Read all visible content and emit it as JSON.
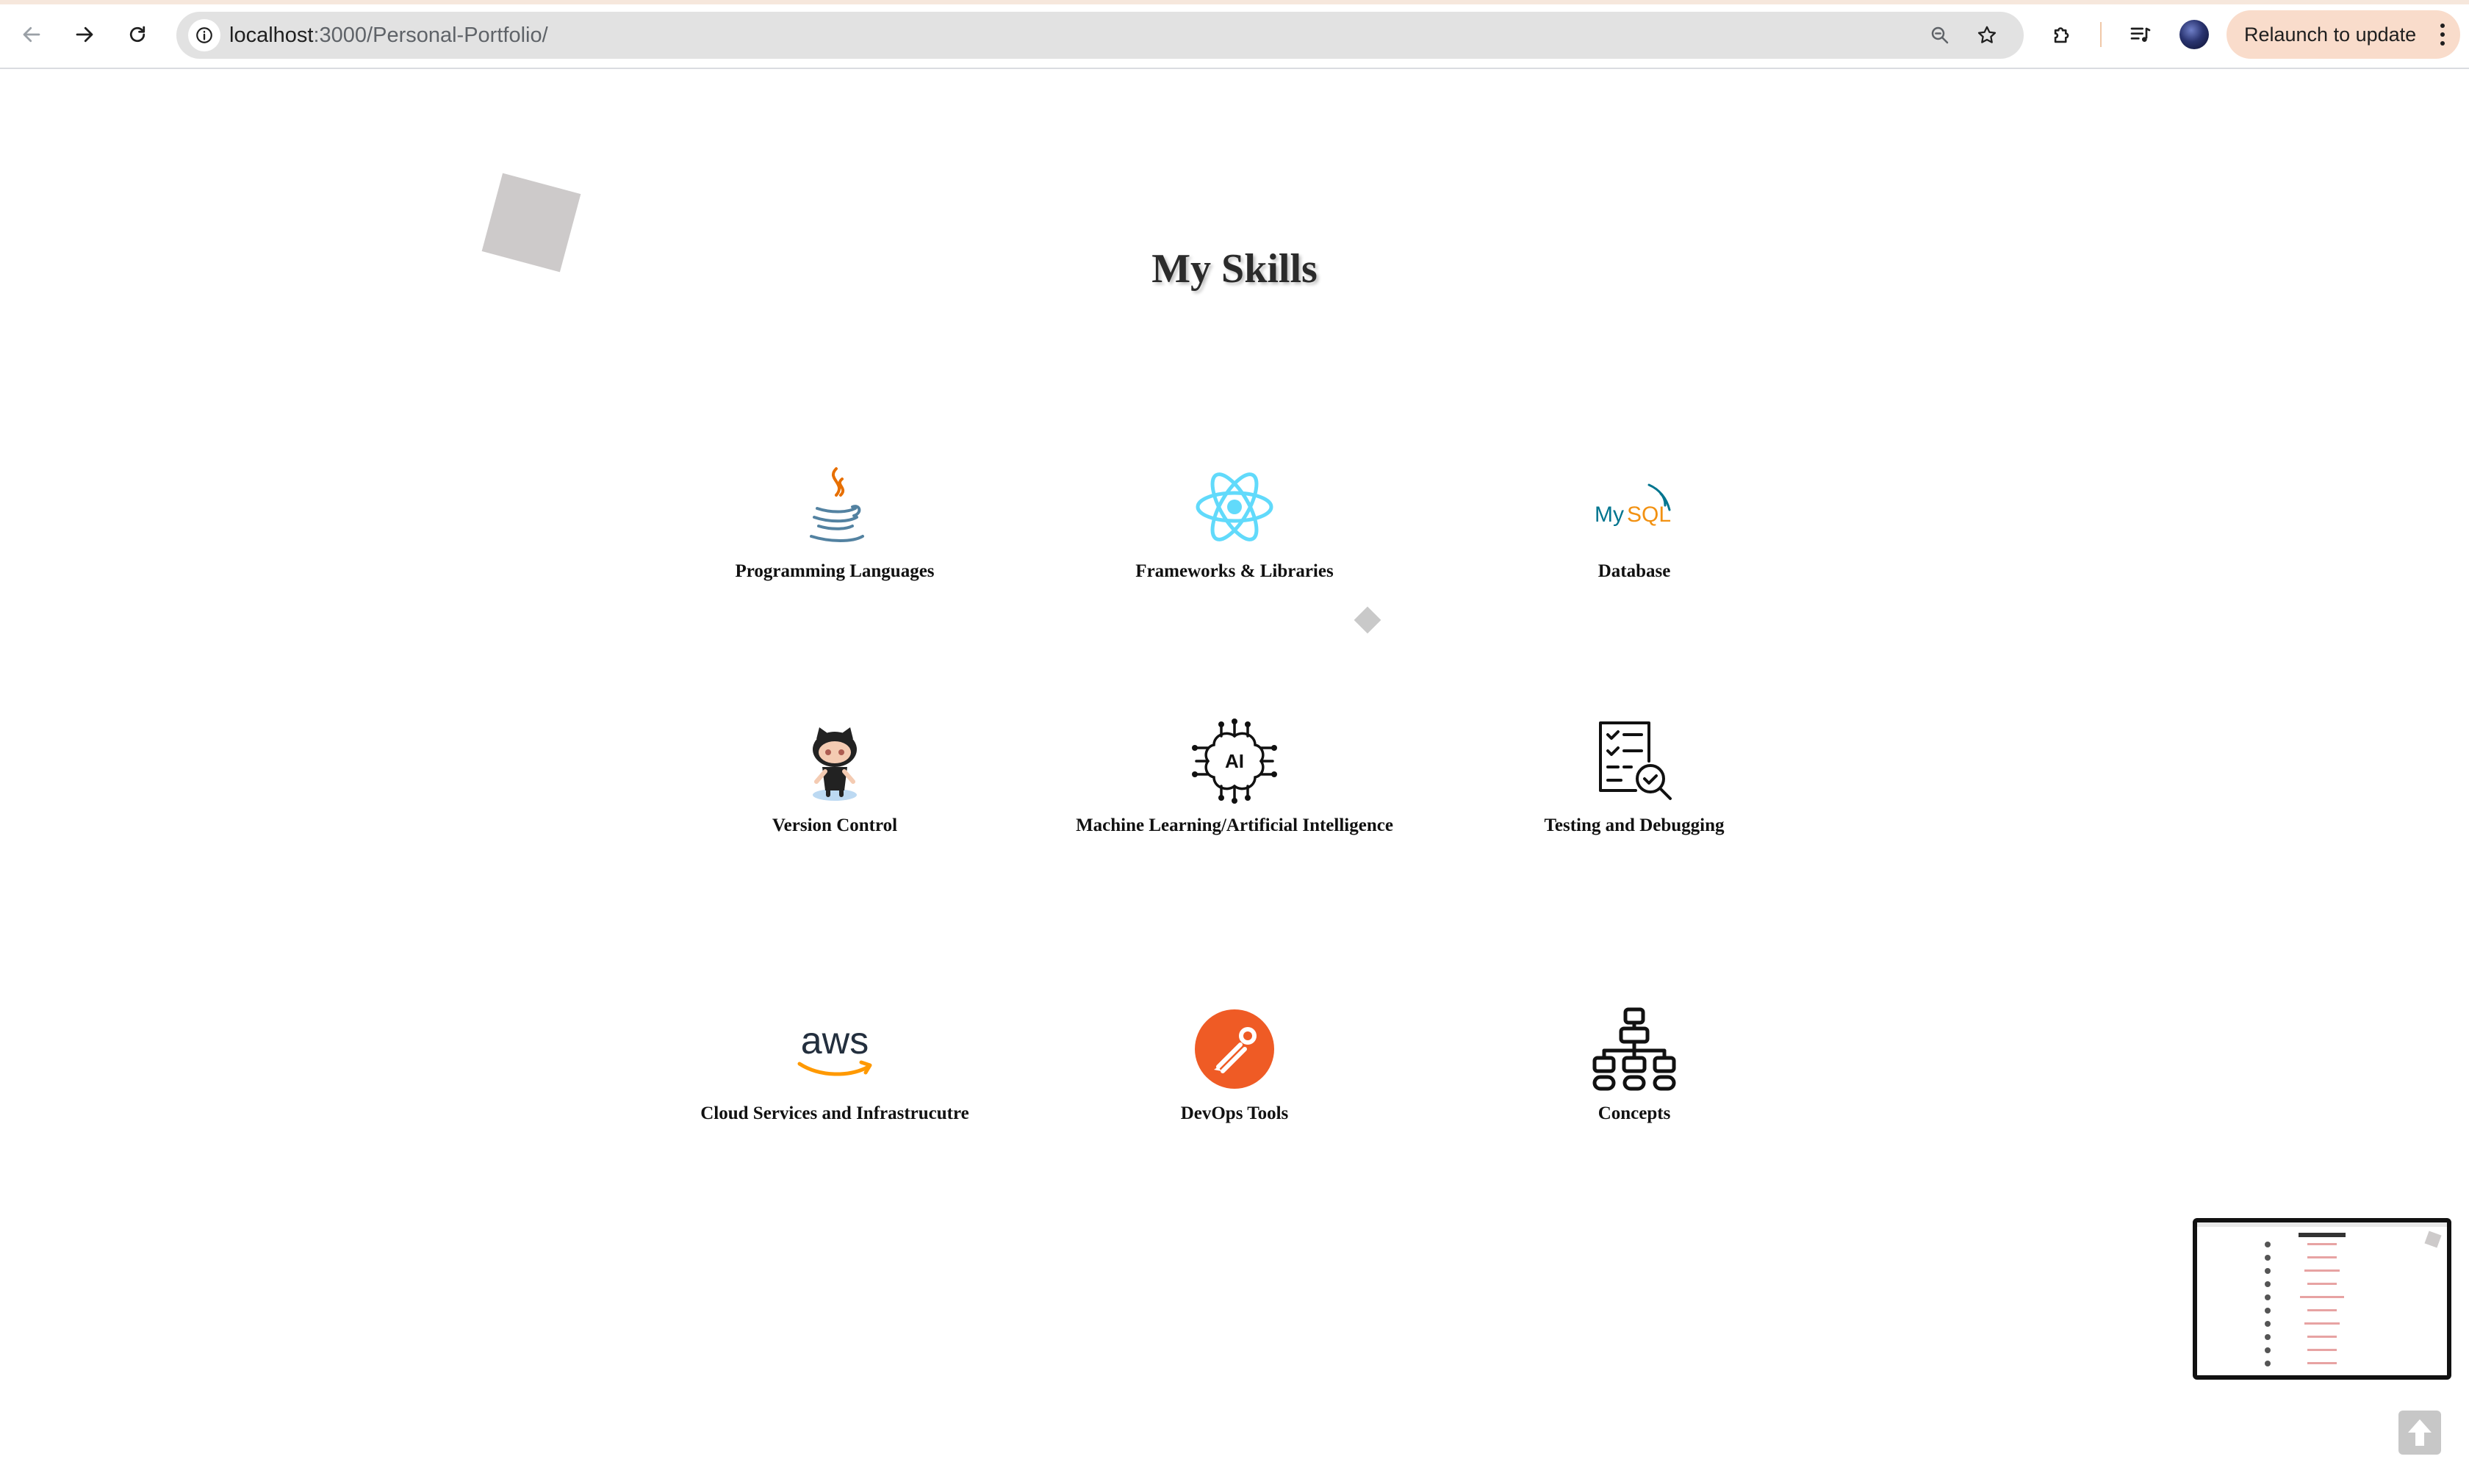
{
  "browser": {
    "url_host": "localhost",
    "url_rest": ":3000/Personal-Portfolio/",
    "relaunch_label": "Relaunch to update"
  },
  "page": {
    "title": "My Skills",
    "skills": [
      {
        "label": "Programming Languages",
        "icon": "java-icon"
      },
      {
        "label": "Frameworks & Libraries",
        "icon": "react-icon"
      },
      {
        "label": "Database",
        "icon": "mysql-icon"
      },
      {
        "label": "Version Control",
        "icon": "github-octocat-icon"
      },
      {
        "label": "Machine Learning/Artificial Intelligence",
        "icon": "ai-brain-icon"
      },
      {
        "label": "Testing and Debugging",
        "icon": "test-checklist-icon"
      },
      {
        "label": "Cloud Services and Infrastrucutre",
        "icon": "aws-icon"
      },
      {
        "label": "DevOps Tools",
        "icon": "postman-icon"
      },
      {
        "label": "Concepts",
        "icon": "hierarchy-icon"
      }
    ]
  },
  "colors": {
    "java_orange": "#e76f00",
    "java_blue": "#5382a1",
    "react_cyan": "#61dafb",
    "mysql_blue": "#00758f",
    "mysql_orange": "#f29111",
    "aws_dark": "#232f3e",
    "aws_orange": "#ff9900",
    "postman_orange": "#ef5b25"
  }
}
